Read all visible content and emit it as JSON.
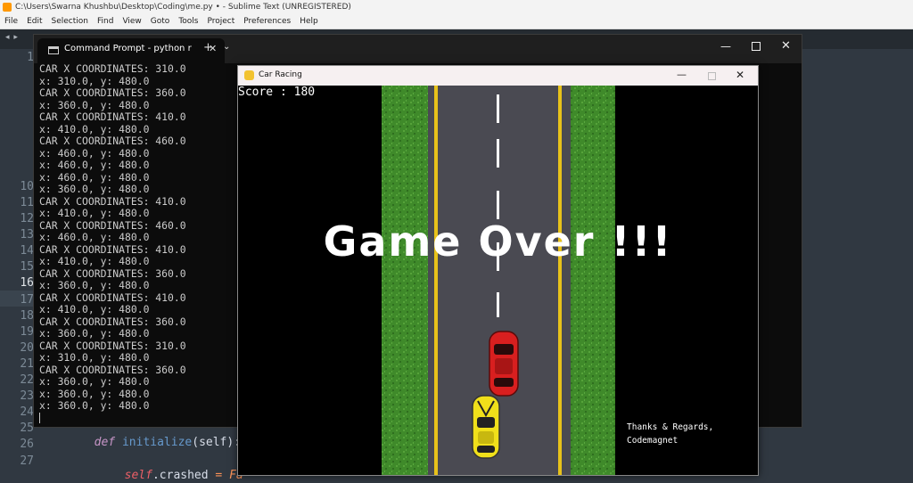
{
  "sublime": {
    "title": "C:\\Users\\Swarna Khushbu\\Desktop\\Coding\\me.py • - Sublime Text (UNREGISTERED)",
    "menu": [
      "File",
      "Edit",
      "Selection",
      "Find",
      "View",
      "Goto",
      "Tools",
      "Project",
      "Preferences",
      "Help"
    ],
    "tab_arrows": "◂ ▸",
    "line_numbers": [
      "1",
      "",
      "",
      "",
      "",
      "",
      "",
      "",
      "10",
      "11",
      "12",
      "13",
      "14",
      "15",
      "16",
      "17",
      "18",
      "19",
      "20",
      "21",
      "22",
      "23",
      "24",
      "25",
      "26",
      "27"
    ],
    "code": {
      "def_kw": "def",
      "func": "initialize",
      "args": "(self):",
      "self_kw": "self",
      "attr": ".crashed ",
      "eq": "=",
      "val": " Fa"
    }
  },
  "cmd": {
    "tab_label": "Command Prompt - python  r",
    "tab_close": "✕",
    "plus": "+",
    "dropdown": "⌄",
    "min": "—",
    "close": "✕",
    "lines": [
      "CAR X COORDINATES: 310.0",
      "x: 310.0, y: 480.0",
      "CAR X COORDINATES: 360.0",
      "x: 360.0, y: 480.0",
      "CAR X COORDINATES: 410.0",
      "x: 410.0, y: 480.0",
      "CAR X COORDINATES: 460.0",
      "x: 460.0, y: 480.0",
      "x: 460.0, y: 480.0",
      "x: 460.0, y: 480.0",
      "x: 360.0, y: 480.0",
      "CAR X COORDINATES: 410.0",
      "x: 410.0, y: 480.0",
      "CAR X COORDINATES: 460.0",
      "x: 460.0, y: 480.0",
      "CAR X COORDINATES: 410.0",
      "x: 410.0, y: 480.0",
      "CAR X COORDINATES: 360.0",
      "x: 360.0, y: 480.0",
      "CAR X COORDINATES: 410.0",
      "x: 410.0, y: 480.0",
      "CAR X COORDINATES: 360.0",
      "x: 360.0, y: 480.0",
      "CAR X COORDINATES: 310.0",
      "x: 310.0, y: 480.0",
      "CAR X COORDINATES: 360.0",
      "x: 360.0, y: 480.0",
      "x: 360.0, y: 480.0",
      "x: 360.0, y: 480.0"
    ]
  },
  "game": {
    "window_title": "Car Racing",
    "min": "—",
    "close": "✕",
    "score_text": "Score : 180",
    "game_over_text": "Game Over !!!",
    "credits_line1": "Thanks & Regards,",
    "credits_line2": "Codemagnet",
    "colors": {
      "grass": "#3f8a2a",
      "road": "#4a4a52",
      "lane_yellow": "#e8c21a",
      "player_car": "#f0e01a",
      "enemy_car": "#d81f1f"
    }
  }
}
